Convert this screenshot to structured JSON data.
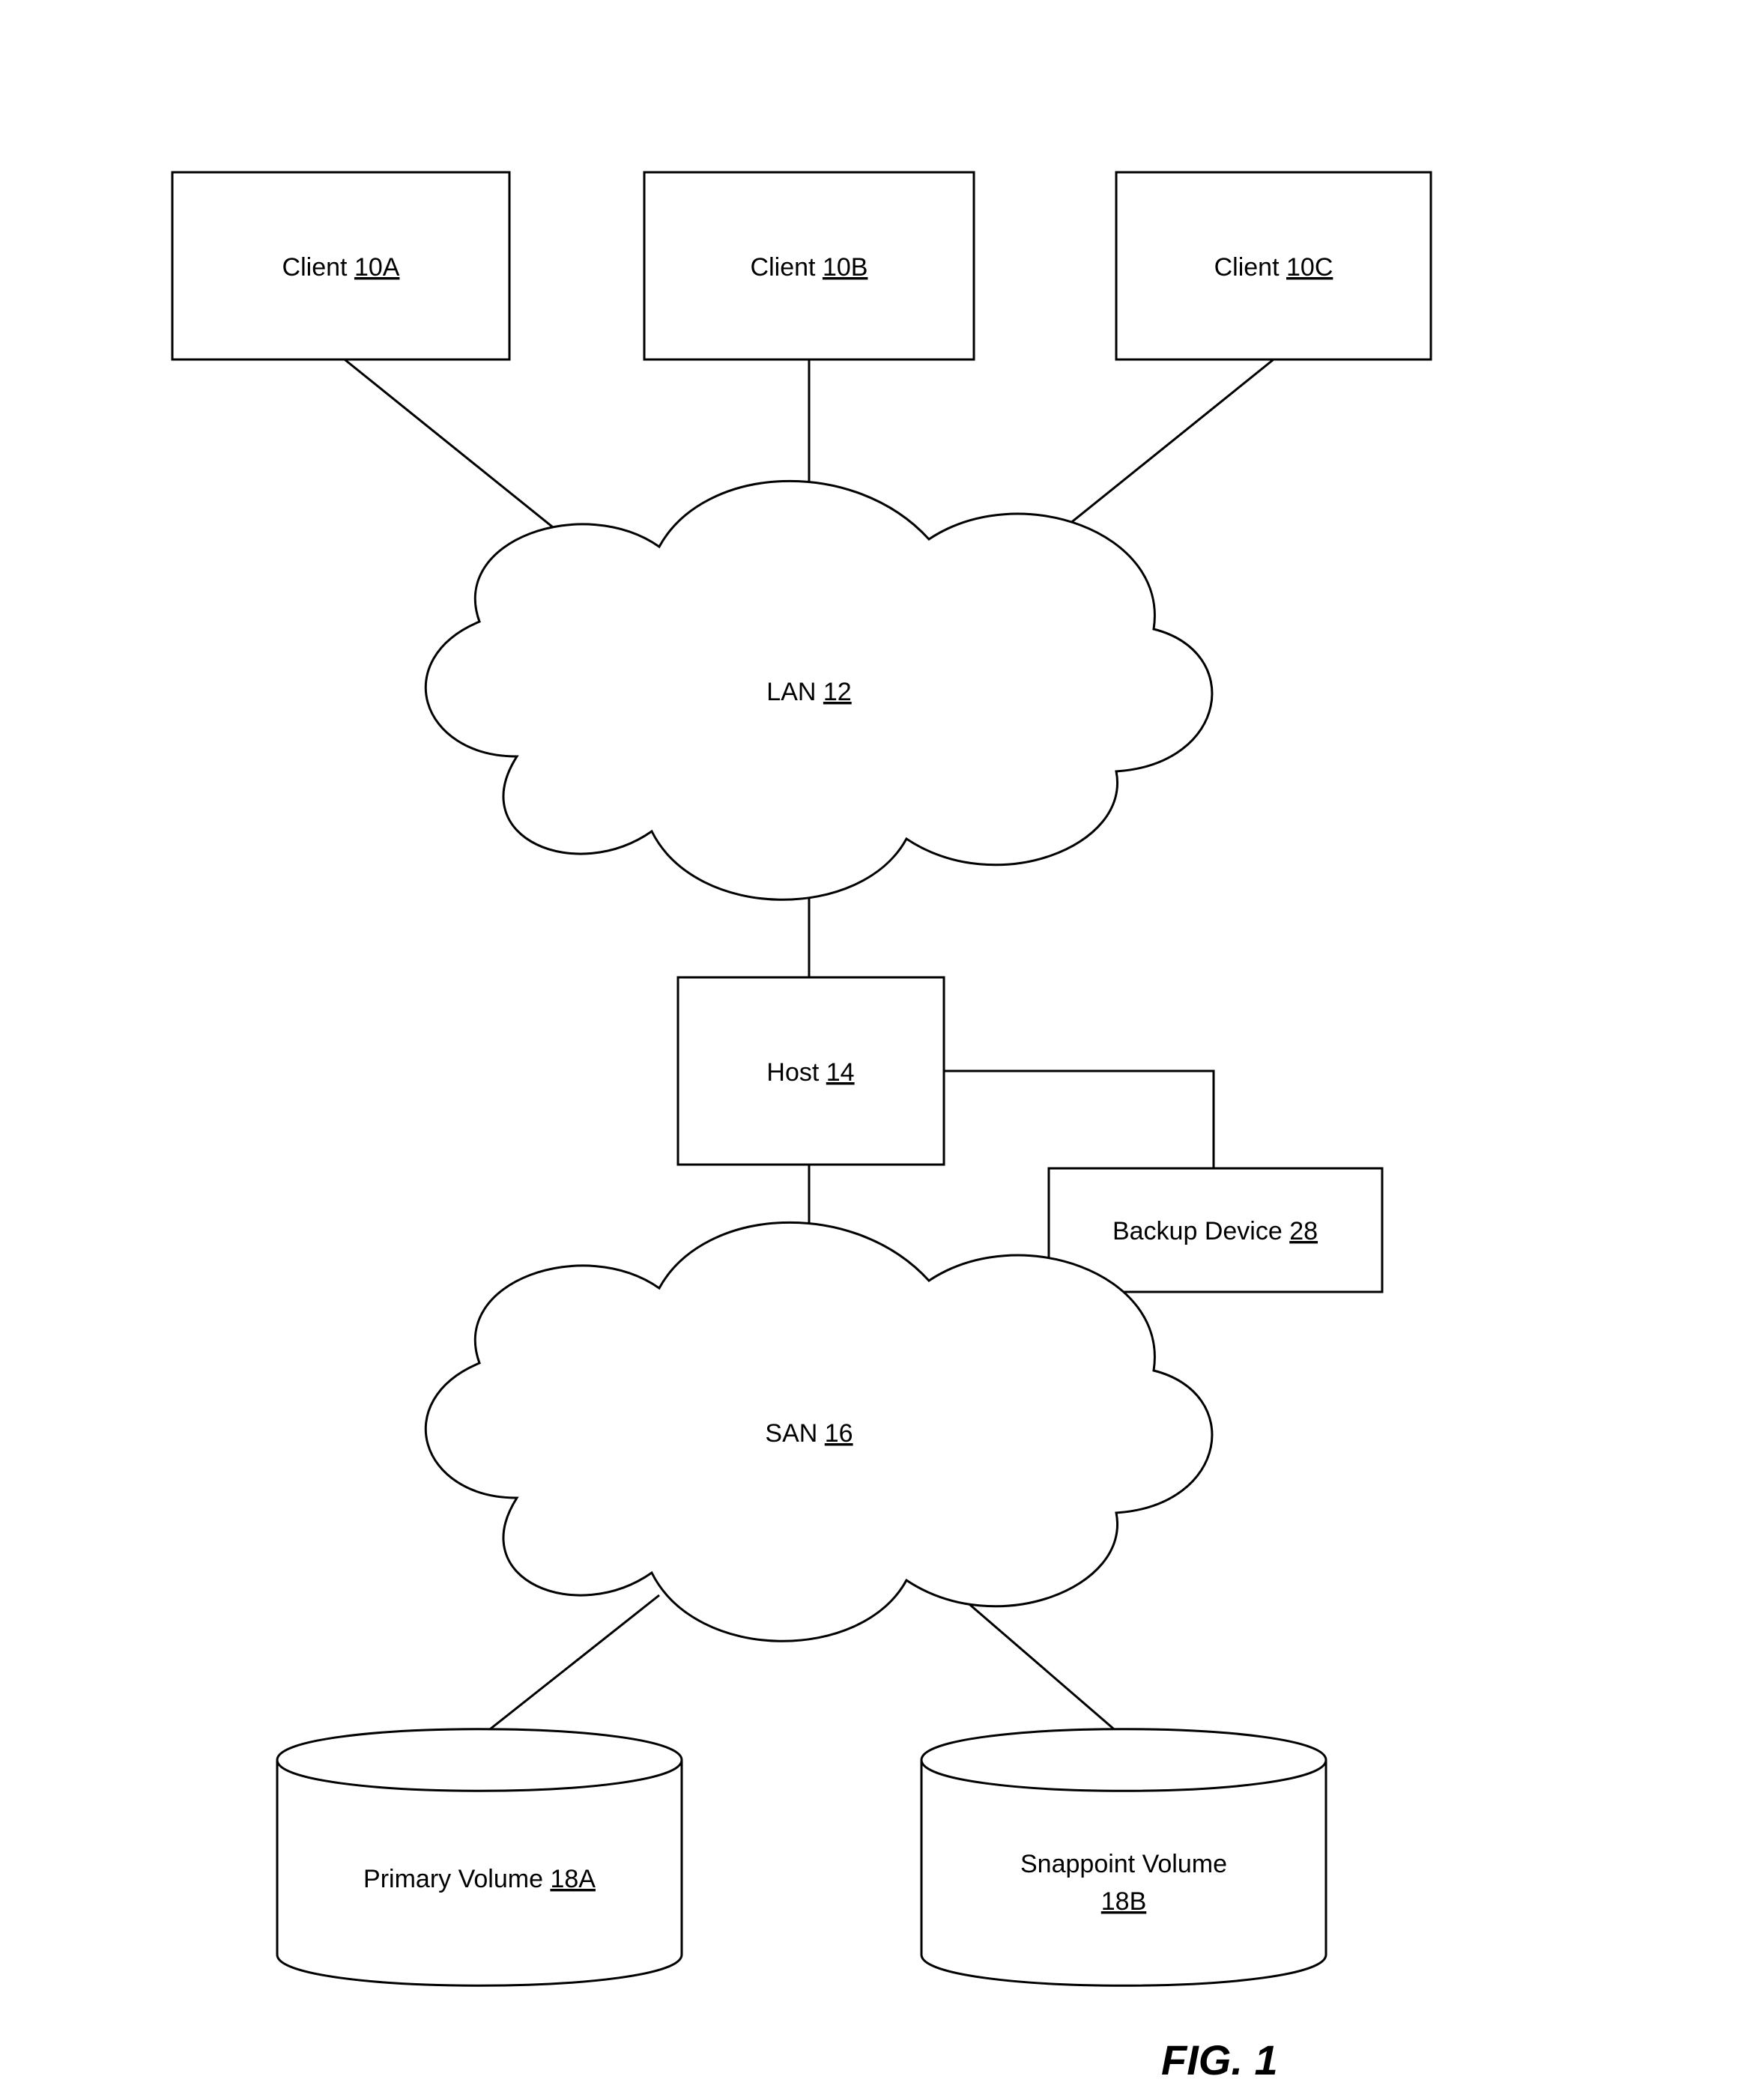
{
  "clients": [
    {
      "label": "Client",
      "ref": "10A"
    },
    {
      "label": "Client",
      "ref": "10B"
    },
    {
      "label": "Client",
      "ref": "10C"
    }
  ],
  "lan": {
    "label": "LAN",
    "ref": "12"
  },
  "host": {
    "label": "Host",
    "ref": "14"
  },
  "backup": {
    "label": "Backup Device",
    "ref": "28"
  },
  "san": {
    "label": "SAN",
    "ref": "16"
  },
  "volumes": [
    {
      "label": "Primary Volume",
      "ref": "18A"
    },
    {
      "label": "Snappoint Volume",
      "ref": "18B"
    }
  ],
  "figure": "FIG. 1"
}
